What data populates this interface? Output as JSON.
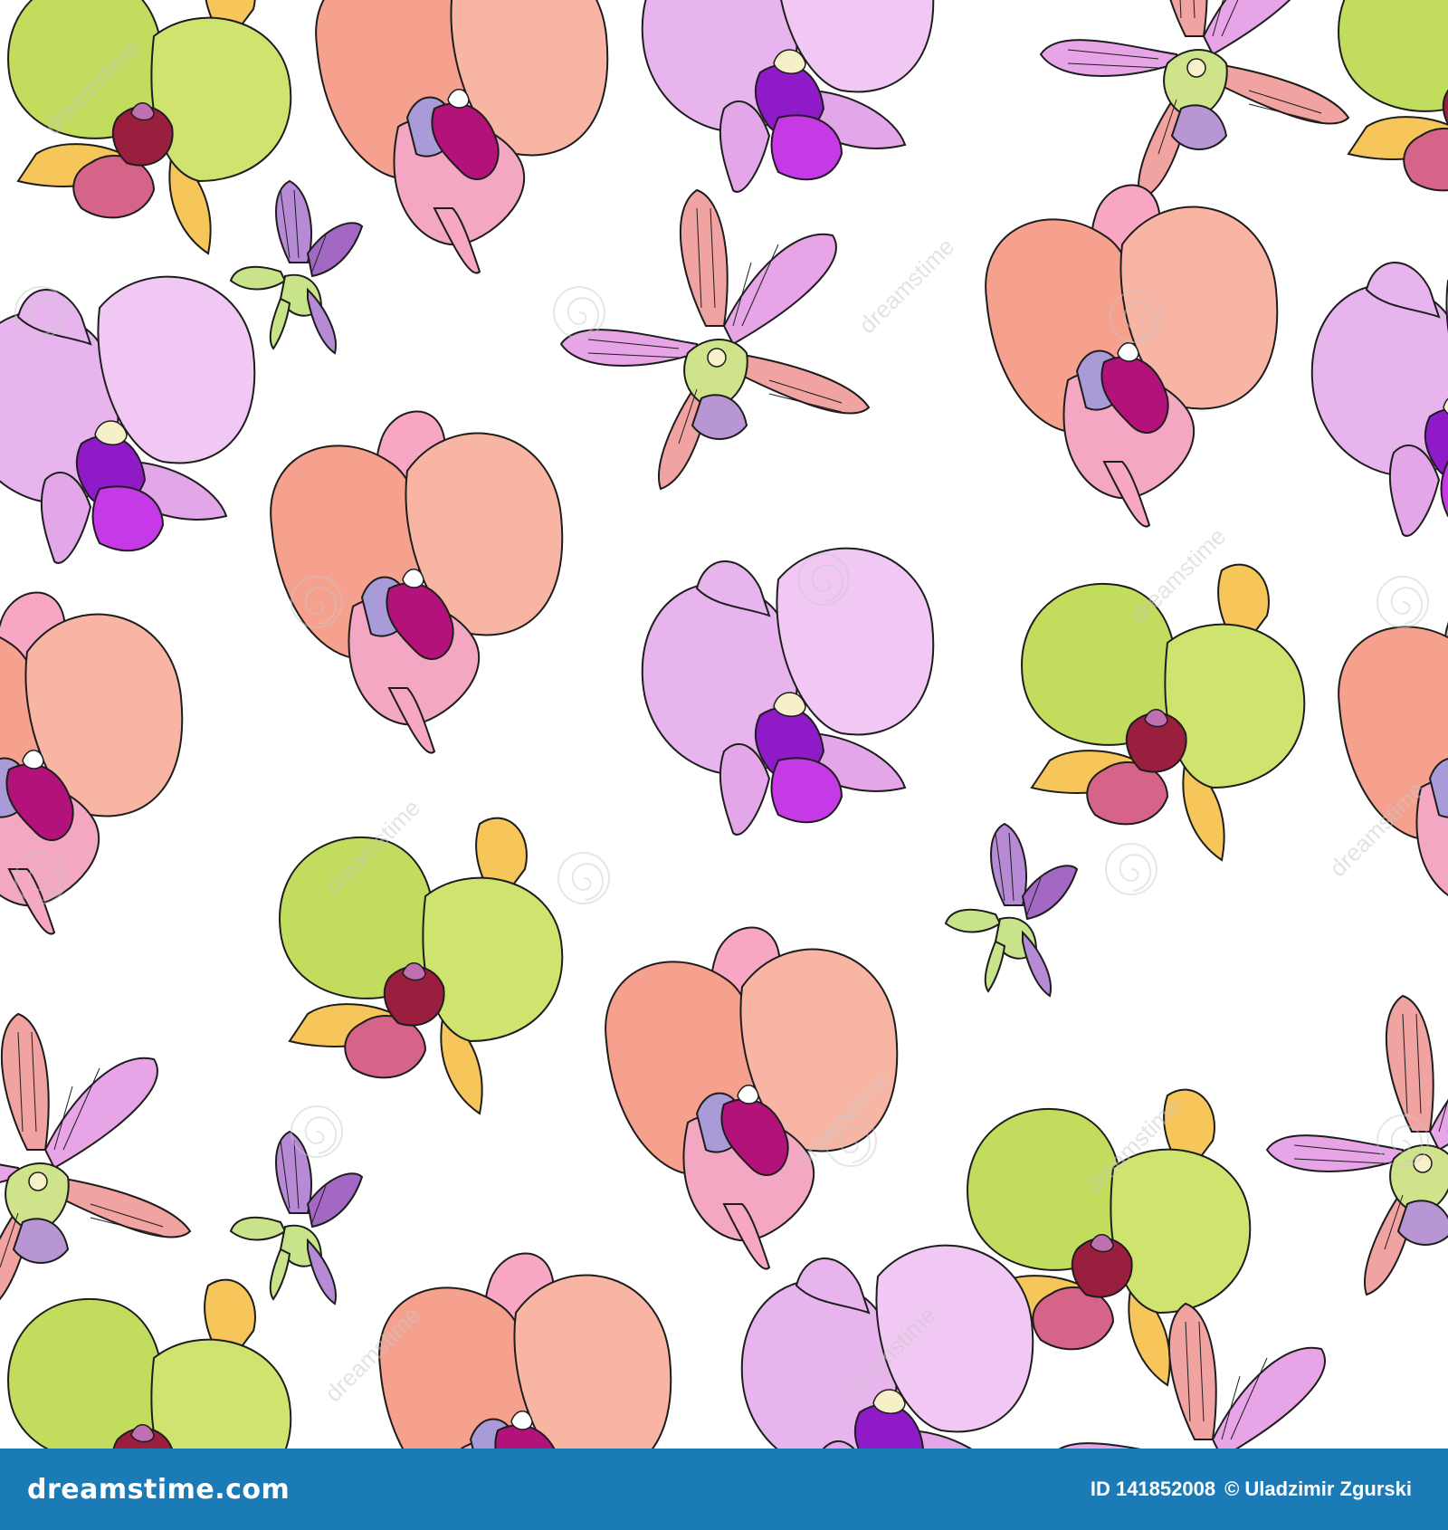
{
  "pattern": {
    "description_kind": "seamless orchid pattern",
    "background_color": "#ffffff",
    "flower_palettes": {
      "coral": {
        "petal": "#f6a08e",
        "petal2": "#f9b5a3",
        "lip": "#f3a7c2",
        "column": "#b2127a",
        "accent": "#a99ad8"
      },
      "lavender": {
        "petal": "#e8b4ee",
        "petal2": "#f0c8f3",
        "lip": "#e3a6e9",
        "column": "#8f1bc8",
        "accent": "#c639e6"
      },
      "green": {
        "petal": "#c2dc5e",
        "petal2": "#cfe46f",
        "lip": "#f6c65a",
        "column": "#9a1f3f",
        "accent": "#d56488"
      },
      "striped": {
        "petal": "#f0a3a0",
        "petal2": "#e7a4e6",
        "lip": "#cfe38b",
        "column": "#f7f0c8",
        "accent": "#b796d3"
      },
      "bud": {
        "petal": "#b78ad6",
        "petal2": "#c8e38a",
        "lip": "#a367c4",
        "column": "#f6f0d6",
        "accent": "#8f5bb0"
      }
    },
    "outline_color": "#1d1d1d"
  },
  "watermark": {
    "text": "dreamstime"
  },
  "footer": {
    "background_color": "#1a7bb6",
    "logo_text": "dreamstime.com",
    "image_id": "ID 141852008",
    "author": "© Uladzimir Zgurski"
  }
}
